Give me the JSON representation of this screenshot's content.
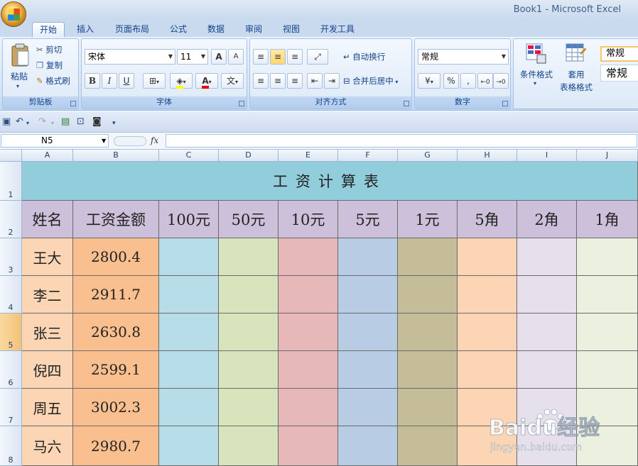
{
  "window": {
    "title": "Book1 - Microsoft Excel"
  },
  "tabs": [
    "开始",
    "插入",
    "页面布局",
    "公式",
    "数据",
    "审阅",
    "视图",
    "开发工具"
  ],
  "ribbon": {
    "clipboard": {
      "paste": "粘贴",
      "cut": "剪切",
      "copy": "复制",
      "format_painter": "格式刷",
      "label": "剪贴板"
    },
    "font": {
      "name": "宋体",
      "size": "11",
      "label": "字体",
      "bold": "B",
      "italic": "I",
      "underline": "U",
      "grow": "A",
      "shrink": "A",
      "font_color": "A",
      "phonetic": "文"
    },
    "alignment": {
      "wrap": "自动换行",
      "merge": "合并后居中",
      "label": "对齐方式"
    },
    "number": {
      "format": "常规",
      "percent": "%",
      "comma": ",",
      "label": "数字"
    },
    "styles": {
      "conditional": "条件格式",
      "table_format": "套用",
      "table_format2": "表格格式",
      "style_normal": "常规",
      "style_normal2": "常规"
    }
  },
  "formula_bar": {
    "name_box": "N5",
    "fx": "fx",
    "content": ""
  },
  "columns": [
    "A",
    "B",
    "C",
    "D",
    "E",
    "F",
    "G",
    "H",
    "I",
    "J"
  ],
  "rows": [
    "1",
    "2",
    "3",
    "4",
    "5",
    "6",
    "7",
    "8"
  ],
  "sheet": {
    "title": "工资计算表",
    "headers": [
      "姓名",
      "工资金额",
      "100元",
      "50元",
      "10元",
      "5元",
      "1元",
      "5角",
      "2角",
      "1角"
    ],
    "data": [
      {
        "name": "王大",
        "amount": "2800.4"
      },
      {
        "name": "李二",
        "amount": "2911.7"
      },
      {
        "name": "张三",
        "amount": "2630.8"
      },
      {
        "name": "倪四",
        "amount": "2599.1"
      },
      {
        "name": "周五",
        "amount": "3002.3"
      },
      {
        "name": "马六",
        "amount": "2980.7"
      }
    ]
  },
  "colors": {
    "title_fill": "#92cddc",
    "header_fill": "#ccc0da",
    "name_fill": "#fcd5b4",
    "amount_fill": "#fabf8f",
    "col_fills": [
      "#b7dde8",
      "#d7e4bc",
      "#e6b9b8",
      "#b8cce4",
      "#c4bd97",
      "#fcd5b4",
      "#e5e0ec",
      "#ebf1de"
    ]
  },
  "watermark": {
    "brand": "Baidu经验",
    "url": "jingyan.baidu.com"
  }
}
